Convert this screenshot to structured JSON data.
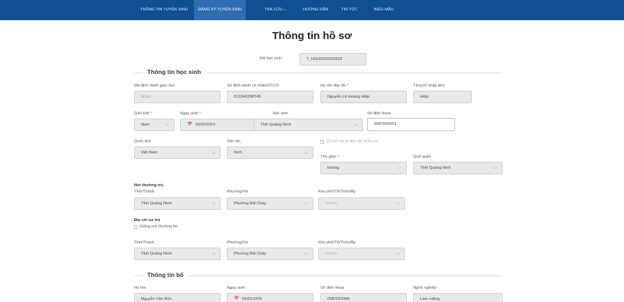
{
  "nav": {
    "items": [
      "THÔNG TIN TUYỂN SINH",
      "ĐĂNG KÝ TUYỂN SINH",
      "TRA CỨU",
      "HƯỚNG DẪN",
      "TIN TỨC",
      "BIỂU MẪU"
    ],
    "chevron": "⌵"
  },
  "page_title": "Thông tin hồ sơ",
  "student_code": {
    "label": "Mã học sinh:",
    "value": "T_HSH2622016510"
  },
  "sections": {
    "student": "Thông tin học sinh",
    "father": "Thông tin bố"
  },
  "student": {
    "edu_id": {
      "label": "Mã định danh giáo dục",
      "placeholder": "Nhập"
    },
    "personal_id": {
      "label": "Số định danh cá nhân/CCCD",
      "value": "012343298745"
    },
    "full_name": {
      "label": "Họ tên đầy đủ",
      "required": "*",
      "value": "Nguyễn Lê Hoàng Hiệp"
    },
    "given_name": {
      "label": "Tên(chỉ nhập tên)",
      "value": "Hiệp"
    },
    "gender": {
      "label": "Giới tính",
      "required": "*",
      "value": "Nam"
    },
    "dob": {
      "label": "Ngày sinh",
      "required": "*",
      "value": "15/02/2010"
    },
    "birthplace": {
      "label": "Nơi sinh",
      "value": "Tỉnh Quảng Ninh"
    },
    "phone": {
      "label": "Số điện thoại",
      "value": "0987654321"
    },
    "nationality": {
      "label": "Quốc tịch",
      "value": "Việt Nam"
    },
    "ethnicity": {
      "label": "Dân tộc",
      "value": "Kinh"
    },
    "minority_parent": {
      "label": "Có bố mẹ là dân tộc thiểu số"
    },
    "religion": {
      "label": "Tôn giáo",
      "required": "*",
      "value": "Không"
    },
    "hometown": {
      "label": "Quê quán",
      "value": "Tỉnh Quảng Ninh"
    }
  },
  "permanent": {
    "heading": "Nơi thường trú",
    "province": {
      "label": "Tỉnh/Thành",
      "value": "Tỉnh Quảng Ninh"
    },
    "ward": {
      "label": "Phường/Xã",
      "value": "Phường Bãi Cháy"
    },
    "area": {
      "label": "Khu phố/Tổ/Thôn/Ấp",
      "placeholder": "-Chọn-"
    }
  },
  "residence": {
    "heading": "Địa chỉ cư trú",
    "same_as": "Giống nơi thường trú",
    "province": {
      "label": "Tỉnh/Thành",
      "value": "Tỉnh Quảng Ninh"
    },
    "ward": {
      "label": "Phường/Xã",
      "value": "Phường Bãi Cháy"
    },
    "area": {
      "label": "Khu phố/Tổ/Thôn/Ấp",
      "placeholder": "-Chọn-"
    }
  },
  "father": {
    "name": {
      "label": "Họ tên",
      "value": "Nguyễn Văn Bôn"
    },
    "dob": {
      "label": "Ngày sinh",
      "value": "01/01/1975"
    },
    "phone": {
      "label": "Số điện thoại",
      "value": "0987654345"
    },
    "job": {
      "label": "Nghề nghiệp",
      "value": "Làm ruộng"
    }
  },
  "icons": {
    "calendar": "📅",
    "dropdown": "⌵"
  },
  "colors": {
    "nav_bg": "#0f4f92",
    "nav_active": "#2f6db3",
    "required": "#dd3333"
  }
}
